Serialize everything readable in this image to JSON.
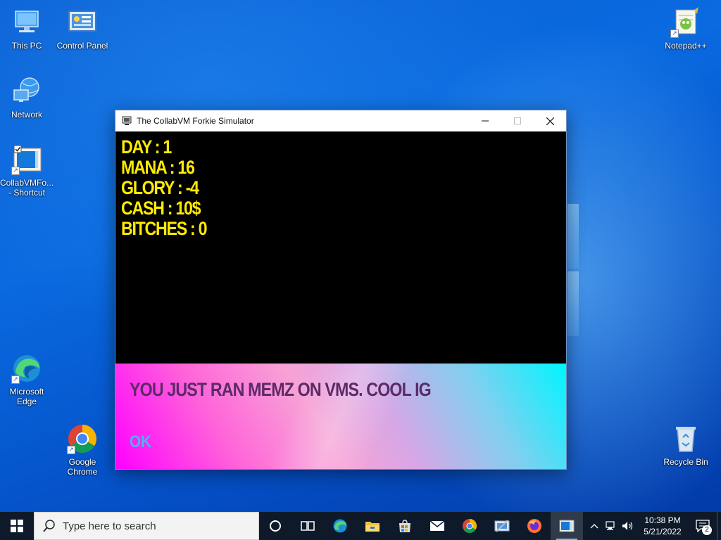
{
  "desktop": {
    "icons": [
      {
        "id": "this-pc",
        "label": "This PC"
      },
      {
        "id": "control-panel",
        "label": "Control Panel"
      },
      {
        "id": "network",
        "label": "Network"
      },
      {
        "id": "collabvm-shortcut",
        "label": "CollabVMFo...\n- Shortcut"
      },
      {
        "id": "microsoft-edge",
        "label": "Microsoft\nEdge"
      },
      {
        "id": "google-chrome",
        "label": "Google\nChrome"
      },
      {
        "id": "notepadpp",
        "label": "Notepad++"
      },
      {
        "id": "recycle-bin",
        "label": "Recycle Bin"
      }
    ]
  },
  "window": {
    "title": "The CollabVM Forkie Simulator",
    "stats": [
      "DAY : 1",
      "MANA : 16",
      "GLORY : -4",
      "CASH : 10$",
      "BITCHES : 0"
    ],
    "message": "YOU JUST RAN MEMZ ON VMS. COOL IG",
    "ok_label": "OK",
    "colors": {
      "stat_text": "#ffeb00",
      "message_text": "#5c2a66",
      "ok_text": "#4ab3f5",
      "gradient_start": "#ff00ff",
      "gradient_end": "#00f5ff"
    }
  },
  "taskbar": {
    "search_placeholder": "Type here to search",
    "pinned": [
      "task-view-icon",
      "edge-icon",
      "file-explorer-icon",
      "store-icon",
      "mail-icon",
      "chrome-icon",
      "control-panel-icon",
      "firefox-icon",
      "collabvm-app-icon"
    ],
    "clock": {
      "time": "10:38 PM",
      "date": "5/21/2022"
    },
    "notification_count": "2"
  }
}
